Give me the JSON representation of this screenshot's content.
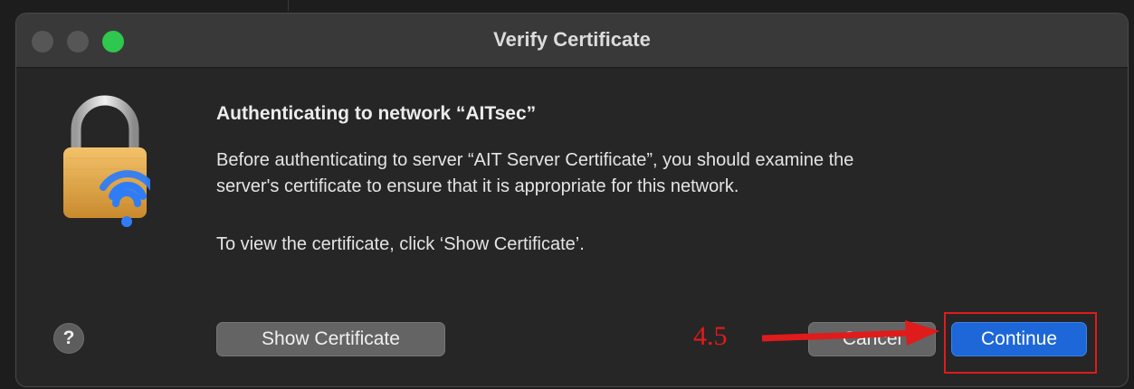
{
  "window": {
    "title": "Verify Certificate",
    "traffic_lights": {
      "close_color": "#565656",
      "minimize_color": "#565656",
      "zoom_color": "#2dc84d"
    }
  },
  "content": {
    "icon": "lock-wifi-icon",
    "heading": "Authenticating to network “AITsec”",
    "body_line1": "Before authenticating to server “AIT Server Certificate”, you should examine the",
    "body_line2": "server's certificate to ensure that it is appropriate for this network.",
    "body_line3": "To view the certificate, click ‘Show Certificate’."
  },
  "buttons": {
    "help_label": "?",
    "show_certificate_label": "Show Certificate",
    "cancel_label": "Cancel",
    "continue_label": "Continue"
  },
  "annotation": {
    "step_label": "4.5",
    "color": "#e01b1b"
  },
  "colors": {
    "accent": "#1d67d8",
    "dialog_bg": "#262626",
    "titlebar_bg": "#393939"
  }
}
